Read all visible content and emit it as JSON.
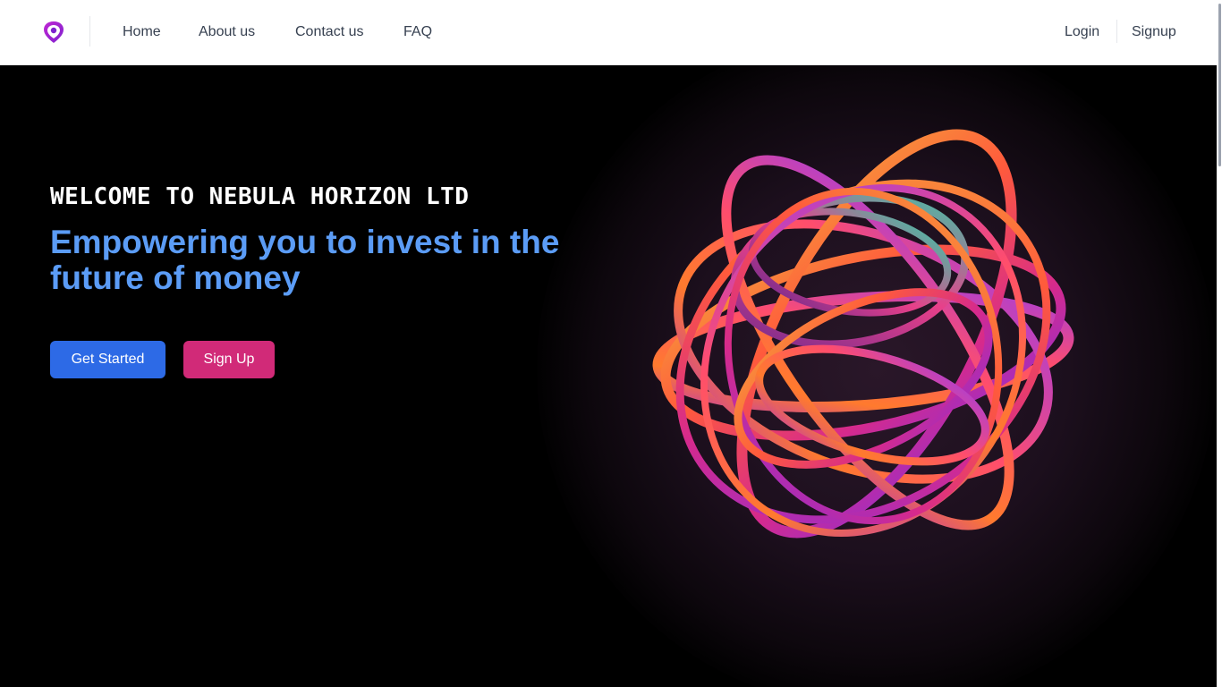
{
  "nav": {
    "logo": "nebula-logo-icon",
    "links": [
      "Home",
      "About us",
      "Contact us",
      "FAQ"
    ],
    "login": "Login",
    "signup": "Signup"
  },
  "hero": {
    "eyebrow": "WELCOME TO NEBULA HORIZON LTD",
    "headline": "Empowering you to invest in the future of money",
    "primary_button": "Get Started",
    "secondary_button": "Sign Up",
    "art": "abstract-ribbon-sphere"
  },
  "colors": {
    "headline": "#5b9cf6",
    "primary_button": "#2d6ae6",
    "secondary_button": "#d12a78",
    "logo_purple": "#a21caf"
  }
}
